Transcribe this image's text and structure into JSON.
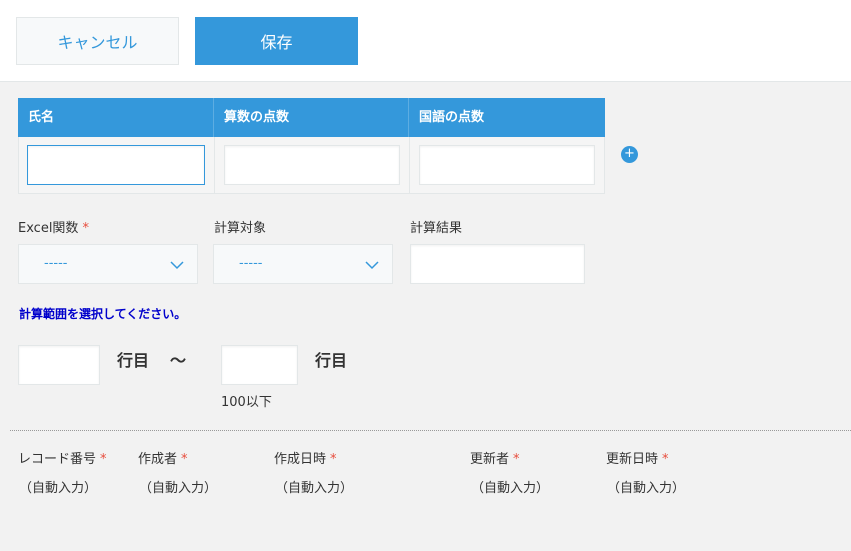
{
  "toolbar": {
    "cancel_label": "キャンセル",
    "save_label": "保存"
  },
  "subtable": {
    "columns": [
      "氏名",
      "算数の点数",
      "国語の点数"
    ],
    "row_values": [
      "",
      "",
      ""
    ],
    "add_row_symbol": "+"
  },
  "fields": {
    "excel_func": {
      "label": "Excel関数",
      "required": "*",
      "value": "-----"
    },
    "calc_target": {
      "label": "計算対象",
      "value": "-----"
    },
    "calc_result": {
      "label": "計算結果",
      "value": ""
    }
  },
  "range": {
    "notice": "計算範囲を選択してください。",
    "from_value": "",
    "from_suffix": "行目",
    "separator": "～",
    "to_value": "",
    "to_suffix": "行目",
    "hint": "100以下"
  },
  "system_fields": [
    {
      "label": "レコード番号",
      "required": "*",
      "value": "（自動入力）"
    },
    {
      "label": "作成者",
      "required": "*",
      "value": "（自動入力）"
    },
    {
      "label": "作成日時",
      "required": "*",
      "value": "（自動入力）"
    },
    {
      "label": "更新者",
      "required": "*",
      "value": "（自動入力）"
    },
    {
      "label": "更新日時",
      "required": "*",
      "value": "（自動入力）"
    }
  ],
  "colors": {
    "accent": "#3498db",
    "required": "#e74c3c",
    "notice": "#0000cc",
    "background": "#f2f2f2"
  }
}
